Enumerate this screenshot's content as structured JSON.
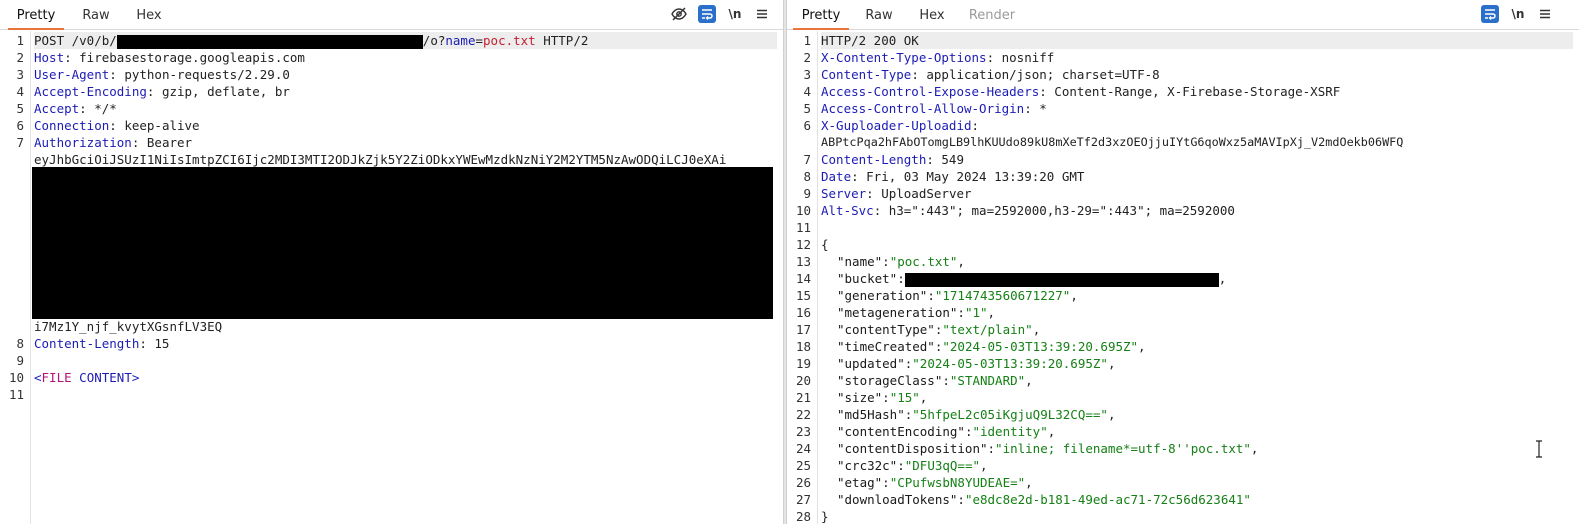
{
  "request": {
    "tabs": [
      {
        "label": "Pretty",
        "active": true
      },
      {
        "label": "Raw",
        "active": false
      },
      {
        "label": "Hex",
        "active": false
      }
    ],
    "toolbar": {
      "newline_label": "\\n"
    },
    "line_numbers": [
      "1",
      "2",
      "3",
      "4",
      "5",
      "6",
      "7",
      "8",
      "9",
      "10",
      "11"
    ],
    "lines": {
      "l1_method": "POST /v0/b/",
      "l1_query": "/o?",
      "l1_param_name": "name",
      "l1_eq": "=",
      "l1_param_value": "poc.txt",
      "l1_proto": " HTTP/2",
      "l2_key": "Host",
      "l2_val": ": firebasestorage.googleapis.com",
      "l3_key": "User-Agent",
      "l3_val": ": python-requests/2.29.0",
      "l4_key": "Accept-Encoding",
      "l4_val": ": gzip, deflate, br",
      "l5_key": "Accept",
      "l5_val": ": */*",
      "l6_key": "Connection",
      "l6_val": ": keep-alive",
      "l7_key": "Authorization",
      "l7_val": ": Bearer",
      "l7_token_start": "eyJhbGciOiJSUzI1NiIsImtpZCI6Ijc2MDI3MTI2ODJkZjk5Y2ZiODkxYWEwMzdkNzNiY2M2YTM5NzAwODQiLCJ0eXAi",
      "l7_token_end": "i7Mz1Y_njf_kvytXGsnfLV3EQ",
      "l8_key": "Content-Length",
      "l8_val": ": 15",
      "l10_open": "<",
      "l10_tag": "FILE",
      "l10_space": " ",
      "l10_attr": "CONTENT",
      "l10_close": ">"
    }
  },
  "response": {
    "tabs": [
      {
        "label": "Pretty",
        "active": true
      },
      {
        "label": "Raw",
        "active": false
      },
      {
        "label": "Hex",
        "active": false
      },
      {
        "label": "Render",
        "active": false,
        "disabled": true
      }
    ],
    "toolbar": {
      "newline_label": "\\n"
    },
    "line_numbers": [
      "1",
      "2",
      "3",
      "4",
      "5",
      "6",
      "",
      "7",
      "8",
      "9",
      "10",
      "11",
      "12",
      "13",
      "14",
      "15",
      "16",
      "17",
      "18",
      "19",
      "20",
      "21",
      "22",
      "23",
      "24",
      "25",
      "26",
      "27",
      "28"
    ],
    "status": "HTTP/2 200 OK",
    "headers": [
      {
        "key": "X-Content-Type-Options",
        "val": ": nosniff"
      },
      {
        "key": "Content-Type",
        "val": ": application/json; charset=UTF-8"
      },
      {
        "key": "Access-Control-Expose-Headers",
        "val": ": Content-Range, X-Firebase-Storage-XSRF"
      },
      {
        "key": "Access-Control-Allow-Origin",
        "val": ": *"
      },
      {
        "key": "X-Guploader-Uploadid",
        "val": ":"
      },
      {
        "key": "Content-Length",
        "val": ": 549"
      },
      {
        "key": "Date",
        "val": ": Fri, 03 May 2024 13:39:20 GMT"
      },
      {
        "key": "Server",
        "val": ": UploadServer"
      },
      {
        "key": "Alt-Svc",
        "val": ": h3=\":443\"; ma=2592000,h3-29=\":443\"; ma=2592000"
      }
    ],
    "uploadid_value": "ABPtcPqa2hFAbOTomgLB9lhKUUdo89kU8mXeTf2d3xzOEOjjuIYtG6qoWxz5aMAVIpXj_V2mdOekb06WFQ",
    "json_open": "{",
    "json_close": "}",
    "json_fields": [
      {
        "key": "\"name\"",
        "val": "\"poc.txt\""
      },
      {
        "key": "\"bucket\"",
        "val": ""
      },
      {
        "key": "\"generation\"",
        "val": "\"1714743560671227\""
      },
      {
        "key": "\"metageneration\"",
        "val": "\"1\""
      },
      {
        "key": "\"contentType\"",
        "val": "\"text/plain\""
      },
      {
        "key": "\"timeCreated\"",
        "val": "\"2024-05-03T13:39:20.695Z\""
      },
      {
        "key": "\"updated\"",
        "val": "\"2024-05-03T13:39:20.695Z\""
      },
      {
        "key": "\"storageClass\"",
        "val": "\"STANDARD\""
      },
      {
        "key": "\"size\"",
        "val": "\"15\""
      },
      {
        "key": "\"md5Hash\"",
        "val": "\"5hfpeL2c05iKgjuQ9L32CQ==\""
      },
      {
        "key": "\"contentEncoding\"",
        "val": "\"identity\""
      },
      {
        "key": "\"contentDisposition\"",
        "val": "\"inline; filename*=utf-8''poc.txt\""
      },
      {
        "key": "\"crc32c\"",
        "val": "\"DFU3qQ==\""
      },
      {
        "key": "\"etag\"",
        "val": "\"CPufwsbN8YUDEAE=\""
      },
      {
        "key": "\"downloadTokens\"",
        "val": "\"e8dc8e2d-b181-49ed-ac71-72c56d623641\""
      }
    ],
    "colon": ":",
    "comma": ","
  }
}
